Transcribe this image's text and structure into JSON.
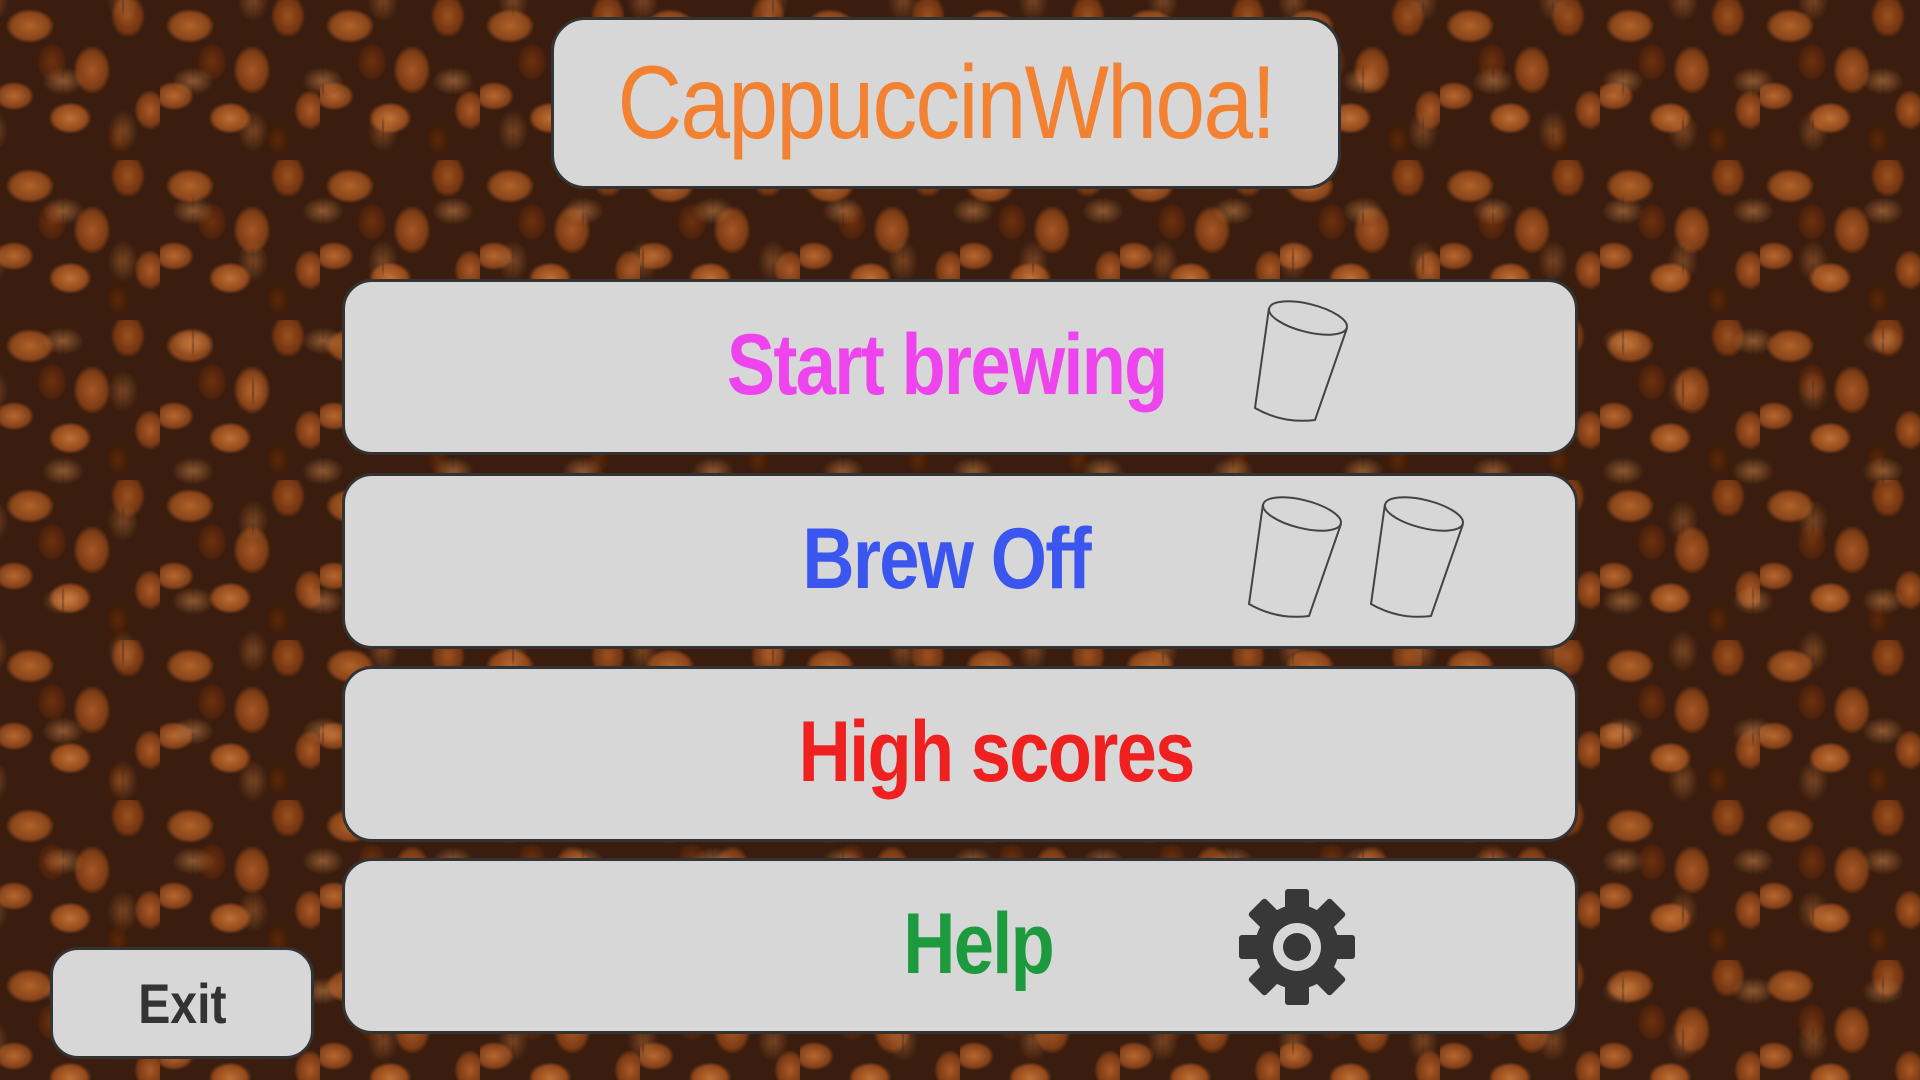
{
  "title": "CappuccinWhoa!",
  "menu": {
    "start_brewing": {
      "label": "Start brewing",
      "color": "#ee44ee",
      "icon": "cup-icon"
    },
    "brew_off": {
      "label": "Brew Off",
      "color": "#3a56ee",
      "icon": "two-cups-icon"
    },
    "high_scores": {
      "label": "High scores",
      "color": "#ee2020"
    },
    "help": {
      "label": "Help",
      "color": "#1e9a3e",
      "icon": "gear-icon"
    }
  },
  "exit": {
    "label": "Exit"
  },
  "colors": {
    "title": "#f28231",
    "panel_bg": "#d7d7d7",
    "panel_border": "#333333",
    "background": "coffee-beans"
  }
}
